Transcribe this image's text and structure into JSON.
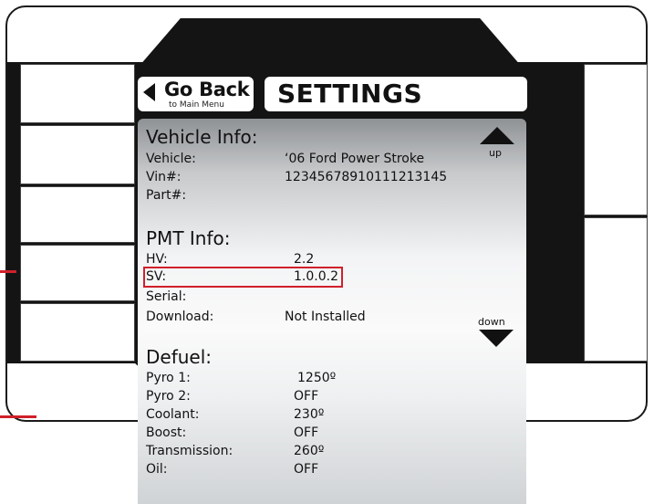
{
  "header": {
    "back_label": "Go Back",
    "back_sublabel": "to Main Menu",
    "title": "SETTINGS"
  },
  "vehicle_info": {
    "heading": "Vehicle Info:",
    "rows": [
      {
        "label": "Vehicle:",
        "value": "‘06 Ford Power Stroke"
      },
      {
        "label": "Vin#:",
        "value": "12345678910111213145"
      },
      {
        "label": "Part#:",
        "value": ""
      }
    ]
  },
  "pmt_info": {
    "heading": "PMT Info:",
    "rows": [
      {
        "label": "HV:",
        "value": "2.2"
      },
      {
        "label": "SV:",
        "value": "1.0.0.2"
      },
      {
        "label": "Serial:",
        "value": ""
      },
      {
        "label": "Download:",
        "value": "Not Installed"
      }
    ]
  },
  "defuel": {
    "heading": "Defuel:",
    "rows": [
      {
        "label": "Pyro 1:",
        "value": "1250º"
      },
      {
        "label": "Pyro 2:",
        "value": "OFF"
      },
      {
        "label": "Coolant:",
        "value": "230º"
      },
      {
        "label": "Boost:",
        "value": "OFF"
      },
      {
        "label": "Transmission:",
        "value": "260º"
      },
      {
        "label": "Oil:",
        "value": "OFF"
      }
    ]
  },
  "scroll": {
    "up_label": "up",
    "down_label": "down",
    "up_icon": "triangle-up-icon",
    "down_icon": "triangle-down-icon"
  },
  "colors": {
    "highlight": "#d0202a",
    "bezel": "#141414"
  }
}
